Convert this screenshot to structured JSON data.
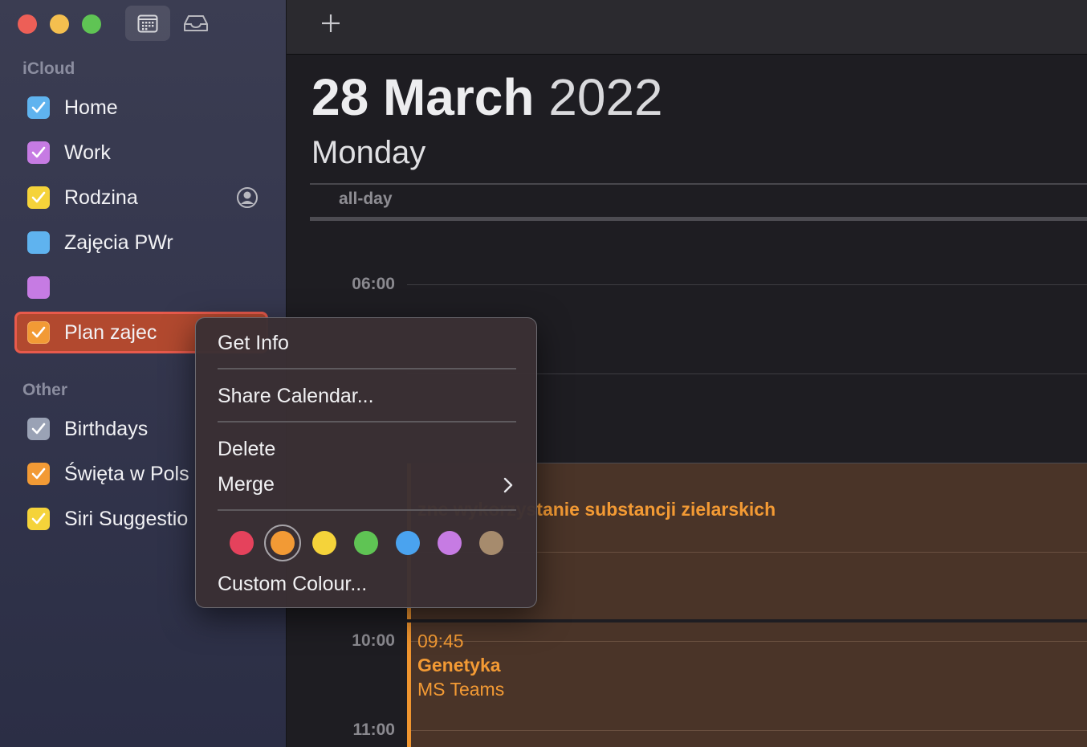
{
  "sidebar": {
    "sections": [
      {
        "label": "iCloud"
      },
      {
        "label": "Other"
      }
    ],
    "calendars": [
      {
        "label": "Home",
        "color": "#5fb3ef",
        "checked": true
      },
      {
        "label": "Work",
        "color": "#c67be3",
        "checked": true
      },
      {
        "label": "Rodzina",
        "color": "#f5d33a",
        "checked": true
      },
      {
        "label": "Zajęcia PWr",
        "color": "#5fb3ef",
        "checked": false
      },
      {
        "label": "",
        "color": "#c67be3",
        "checked": false
      },
      {
        "label": "Plan zajec",
        "color": "#f29a35",
        "checked": true,
        "selected": true
      },
      {
        "label": "Birthdays",
        "color": "#9aa2b5",
        "checked": true
      },
      {
        "label": "Święta w Pols",
        "color": "#f29a35",
        "checked": true
      },
      {
        "label": "Siri Suggestio",
        "color": "#f5d33a",
        "checked": true
      }
    ]
  },
  "day_view": {
    "day_month": "28 March",
    "year": "2022",
    "weekday": "Monday",
    "all_day_label": "all-day",
    "hours": [
      "06:00",
      "10:00",
      "11:00"
    ],
    "events": [
      {
        "title": "zne wykorzystanie substancji zielarskich",
        "time": "",
        "location": ""
      },
      {
        "title": "Genetyka",
        "time": "09:45",
        "location": "MS Teams"
      }
    ]
  },
  "context_menu": {
    "items": [
      "Get Info",
      "Share Calendar...",
      "Delete",
      "Merge"
    ],
    "custom_colour": "Custom Colour...",
    "colors": [
      "#e5425c",
      "#f29a35",
      "#f5d33a",
      "#5fc454",
      "#4aa3ef",
      "#c67be3",
      "#a68b6d"
    ],
    "selected_color": "#f29a35"
  },
  "theme": {
    "accent": "#f0952f",
    "selection": "#b2492f"
  }
}
